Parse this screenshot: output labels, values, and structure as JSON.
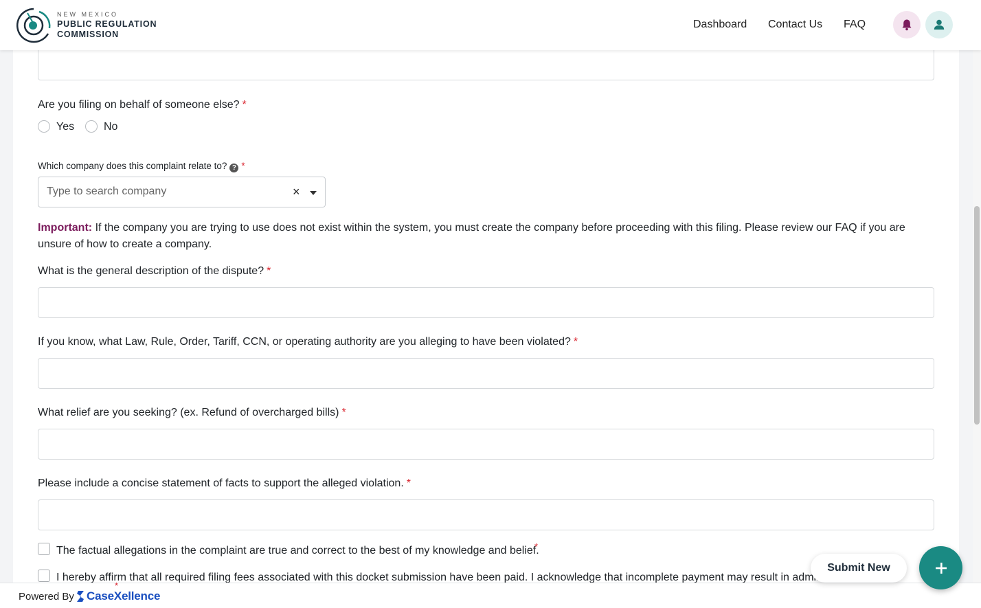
{
  "header": {
    "logo": {
      "line_small": "NEW MEXICO",
      "line_1": "PUBLIC REGULATION",
      "line_2": "COMMISSION"
    },
    "nav": [
      {
        "label": "Dashboard"
      },
      {
        "label": "Contact Us"
      },
      {
        "label": "FAQ"
      }
    ],
    "icons": {
      "notifications": "bell-icon",
      "account": "user-icon"
    },
    "colors": {
      "bell_bg": "#f4e4ef",
      "bell": "#7b1b5c",
      "user_bg": "#ddf0ef",
      "user": "#1a7a74"
    }
  },
  "form": {
    "behalf": {
      "question": "Are you filing on behalf of someone else?",
      "required_mark": "*",
      "options": [
        {
          "label": "Yes"
        },
        {
          "label": "No"
        }
      ]
    },
    "company": {
      "question": "Which company does this complaint relate to?",
      "required_mark": "*",
      "help_icon": "question-circle-icon",
      "placeholder": "Type to search company",
      "clear_glyph": "×"
    },
    "important": {
      "prefix": "Important:",
      "text": "If the company you are trying to use does not exist within the system, you must create the company before proceeding with this filing. Please review our FAQ if you are unsure of how to create a company."
    },
    "dispute": {
      "question": "What is the general description of the dispute?",
      "required_mark": "*",
      "value": ""
    },
    "law": {
      "question": "If you know, what Law, Rule, Order, Tariff, CCN, or operating authority are you alleging to have been violated?",
      "required_mark": "*",
      "value": ""
    },
    "relief": {
      "question": "What relief are you seeking? (ex. Refund of overcharged bills)",
      "required_mark": "*",
      "value": ""
    },
    "facts": {
      "question": "Please include a concise statement of facts to support the alleged violation.",
      "required_mark": "*",
      "value": ""
    },
    "checks": [
      {
        "label": "The factual allegations in the complaint are true and correct to the best of my knowledge and belief.",
        "required_mark": "*"
      },
      {
        "label": "I hereby affirm that all required filing fees associated with this docket submission have been paid. I acknowledge that incomplete payment may result in administrative denial",
        "required_mark": "*"
      }
    ]
  },
  "actions": {
    "submit_new": "Submit New",
    "fab_icon": "plus-icon",
    "accent": "#1a8a83"
  },
  "footer": {
    "powered_by": "Powered By",
    "brand": "CaseXellence",
    "brand_color": "#1a4fc0"
  }
}
